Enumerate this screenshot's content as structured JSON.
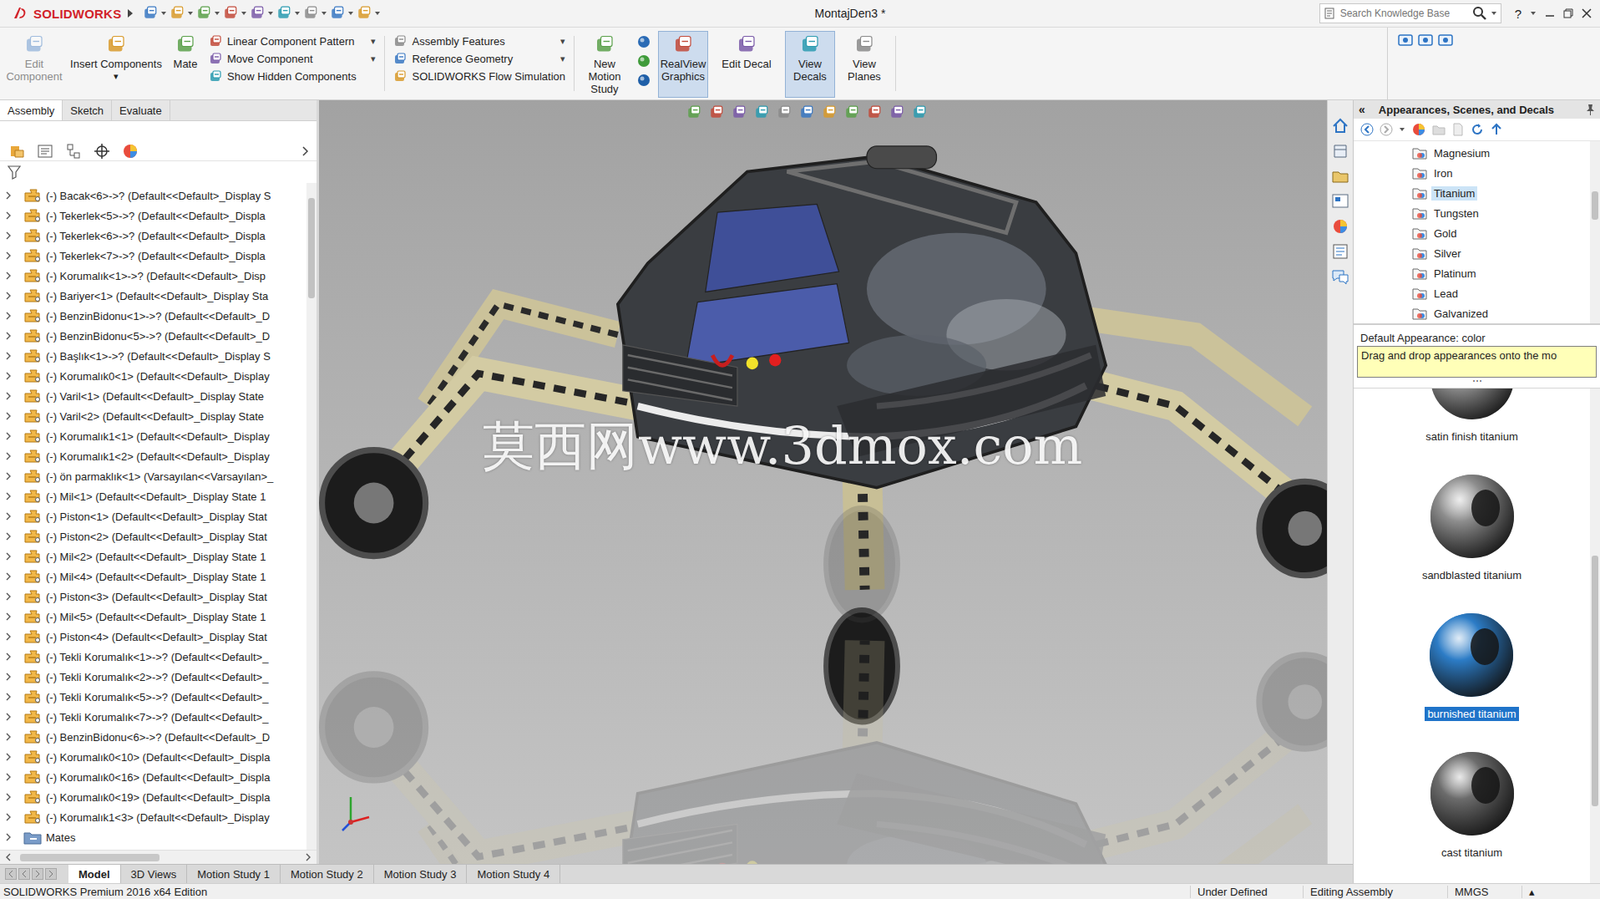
{
  "window": {
    "logo": "SOLIDWORKS",
    "title": "MontajDen3 *",
    "search": {
      "placeholder": "Search Knowledge Base"
    },
    "help": "?"
  },
  "ribbon": {
    "groups": [
      {
        "kind": "large",
        "items": [
          {
            "label": "Edit Component",
            "disabled": true,
            "active": false
          }
        ]
      },
      {
        "kind": "large",
        "items": [
          {
            "label": "Insert Components",
            "dropdown": "▾",
            "disabled": false,
            "active": false
          }
        ]
      },
      {
        "kind": "large",
        "items": [
          {
            "label": "Mate",
            "disabled": false,
            "active": false
          }
        ]
      },
      {
        "kind": "stack",
        "items": [
          {
            "label": "Linear Component Pattern",
            "dropdown": "▾",
            "disabled": false,
            "active": false
          },
          {
            "label": "Move Component",
            "dropdown": "▾",
            "disabled": false,
            "active": false
          },
          {
            "label": "Show Hidden Components",
            "disabled": false,
            "active": false
          }
        ]
      },
      {
        "kind": "stack",
        "items": [
          {
            "label": "Assembly Features",
            "dropdown": "▾",
            "disabled": false,
            "active": false
          },
          {
            "label": "Reference Geometry",
            "dropdown": "▾",
            "disabled": false,
            "active": false
          },
          {
            "label": "SOLIDWORKS Flow Simulation",
            "disabled": false,
            "active": false
          }
        ]
      },
      {
        "kind": "large",
        "items": [
          {
            "label": "New Motion Study",
            "disabled": false,
            "active": false
          }
        ]
      },
      {
        "kind": "icons",
        "items": [
          {
            "active": false
          },
          {
            "active": false
          },
          {
            "active": false
          }
        ]
      },
      {
        "kind": "large",
        "items": [
          {
            "label": "RealView Graphics",
            "disabled": false,
            "active": true
          },
          {
            "label": "Edit Decal",
            "disabled": false,
            "active": false
          },
          {
            "label": "View Decals",
            "disabled": false,
            "active": true
          },
          {
            "label": "View Planes",
            "disabled": false,
            "active": false
          }
        ]
      }
    ]
  },
  "command_tabs": [
    {
      "label": "Assembly",
      "selected": true
    },
    {
      "label": "Sketch",
      "selected": false
    },
    {
      "label": "Evaluate",
      "selected": false
    }
  ],
  "feature_tree": {
    "items": [
      {
        "label": "(-) Bacak<6>->? (Default<<Default>_Display S",
        "kind": "component"
      },
      {
        "label": "(-) Tekerlek<5>->? (Default<<Default>_Displa",
        "kind": "component"
      },
      {
        "label": "(-) Tekerlek<6>->? (Default<<Default>_Displa",
        "kind": "component"
      },
      {
        "label": "(-) Tekerlek<7>->? (Default<<Default>_Displa",
        "kind": "component"
      },
      {
        "label": "(-) Korumalık<1>->? (Default<<Default>_Disp",
        "kind": "component"
      },
      {
        "label": "(-) Bariyer<1> (Default<<Default>_Display Sta",
        "kind": "component"
      },
      {
        "label": "(-) BenzinBidonu<1>->? (Default<<Default>_D",
        "kind": "component"
      },
      {
        "label": "(-) BenzinBidonu<5>->? (Default<<Default>_D",
        "kind": "component"
      },
      {
        "label": "(-) Başlık<1>->? (Default<<Default>_Display S",
        "kind": "component"
      },
      {
        "label": "(-) Korumalık0<1> (Default<<Default>_Display",
        "kind": "component"
      },
      {
        "label": "(-) Varil<1> (Default<<Default>_Display State",
        "kind": "component"
      },
      {
        "label": "(-) Varil<2> (Default<<Default>_Display State",
        "kind": "component"
      },
      {
        "label": "(-) Korumalık1<1> (Default<<Default>_Display",
        "kind": "component"
      },
      {
        "label": "(-) Korumalık1<2> (Default<<Default>_Display",
        "kind": "component"
      },
      {
        "label": "(-) ön parmaklık<1> (Varsayılan<<Varsayılan>_",
        "kind": "component"
      },
      {
        "label": "(-) Mil<1> (Default<<Default>_Display State 1",
        "kind": "component"
      },
      {
        "label": "(-) Piston<1> (Default<<Default>_Display Stat",
        "kind": "component"
      },
      {
        "label": "(-) Piston<2> (Default<<Default>_Display Stat",
        "kind": "component"
      },
      {
        "label": "(-) Mil<2> (Default<<Default>_Display State 1",
        "kind": "component"
      },
      {
        "label": "(-) Mil<4> (Default<<Default>_Display State 1",
        "kind": "component"
      },
      {
        "label": "(-) Piston<3> (Default<<Default>_Display Stat",
        "kind": "component"
      },
      {
        "label": "(-) Mil<5> (Default<<Default>_Display State 1",
        "kind": "component"
      },
      {
        "label": "(-) Piston<4> (Default<<Default>_Display Stat",
        "kind": "component"
      },
      {
        "label": "(-) Tekli Korumalık<1>->? (Default<<Default>_",
        "kind": "component"
      },
      {
        "label": "(-) Tekli Korumalık<2>->? (Default<<Default>_",
        "kind": "component"
      },
      {
        "label": "(-) Tekli Korumalık<5>->? (Default<<Default>_",
        "kind": "component"
      },
      {
        "label": "(-) Tekli Korumalık<7>->? (Default<<Default>_",
        "kind": "component"
      },
      {
        "label": "(-) BenzinBidonu<6>->? (Default<<Default>_D",
        "kind": "component"
      },
      {
        "label": "(-) Korumalık0<10> (Default<<Default>_Displa",
        "kind": "component"
      },
      {
        "label": "(-) Korumalık0<16> (Default<<Default>_Displa",
        "kind": "component"
      },
      {
        "label": "(-) Korumalık0<19> (Default<<Default>_Displa",
        "kind": "component"
      },
      {
        "label": "(-) Korumalık1<3> (Default<<Default>_Display",
        "kind": "component"
      },
      {
        "label": "Mates",
        "kind": "folder"
      }
    ]
  },
  "viewport": {
    "watermark": "莫西网www.3dmox.com"
  },
  "appearances": {
    "collapse": "«",
    "title": "Appearances, Scenes, and Decals",
    "tree": [
      {
        "label": "Magnesium",
        "selected": false
      },
      {
        "label": "Iron",
        "selected": false
      },
      {
        "label": "Titanium",
        "selected": true
      },
      {
        "label": "Tungsten",
        "selected": false
      },
      {
        "label": "Gold",
        "selected": false
      },
      {
        "label": "Silver",
        "selected": false
      },
      {
        "label": "Platinum",
        "selected": false
      },
      {
        "label": "Lead",
        "selected": false
      },
      {
        "label": "Galvanized",
        "selected": false
      }
    ],
    "default_appearance": "Default Appearance: color",
    "hint": "Drag and drop appearances onto the mo",
    "splitter": "⋯",
    "swatches": [
      {
        "label": "satin finish titanium",
        "selected": false,
        "color": "#9c9c9c"
      },
      {
        "label": "sandblasted titanium",
        "selected": false,
        "color": "#8d8d8d"
      },
      {
        "label": "burnished titanium",
        "selected": true,
        "color": "#2c7cc6"
      },
      {
        "label": "cast titanium",
        "selected": false,
        "color": "#6c6c6c"
      }
    ]
  },
  "bottom_tabs": [
    {
      "label": "Model",
      "selected": true
    },
    {
      "label": "3D Views",
      "selected": false
    },
    {
      "label": "Motion Study 1",
      "selected": false
    },
    {
      "label": "Motion Study 2",
      "selected": false
    },
    {
      "label": "Motion Study 3",
      "selected": false
    },
    {
      "label": "Motion Study 4",
      "selected": false
    }
  ],
  "status_bar": {
    "edition": "SOLIDWORKS Premium 2016 x64 Edition",
    "items": [
      "Under Defined",
      "Editing Assembly",
      "MMGS"
    ],
    "arrow": "▴"
  }
}
